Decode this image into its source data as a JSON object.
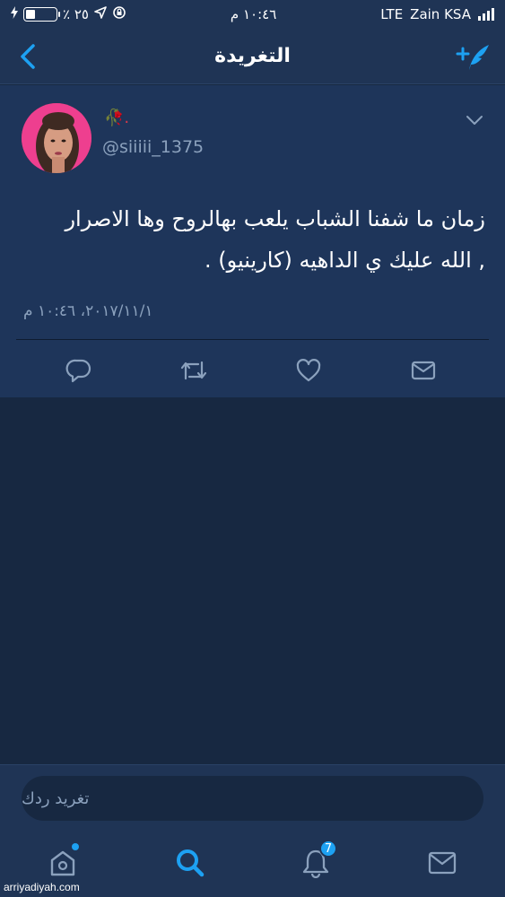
{
  "status_bar": {
    "battery_percent": "٪ ٢٥",
    "time": "١٠:٤٦ م",
    "network": "LTE",
    "carrier": "Zain KSA",
    "icons": [
      "charging-icon",
      "battery-icon",
      "location-icon",
      "rotation-lock-icon",
      "signal-icon"
    ]
  },
  "nav": {
    "title": "التغريدة",
    "back_icon": "chevron-left-icon",
    "compose_icon": "compose-tweet-icon"
  },
  "tweet": {
    "display_name": "🥀.",
    "handle": "@siiiii_1375",
    "text_lines": [
      "زمان ما شفنا الشباب يلعب بهالروح وها الاصرار",
      ", الله عليك ي الداهيه (كارينيو) ."
    ],
    "timestamp": "٢٠١٧/١١/١، ١٠:٤٦ م",
    "actions": [
      "reply-icon",
      "retweet-icon",
      "like-icon",
      "direct-message-icon"
    ]
  },
  "reply": {
    "placeholder": "تغريد ردك"
  },
  "tab_bar": {
    "tabs": [
      "home-icon",
      "search-icon",
      "notifications-icon",
      "messages-icon"
    ],
    "notifications_badge": "7"
  },
  "watermark": "arriyadiyah.com",
  "colors": {
    "background": "#172841",
    "card": "#1e355a",
    "bars": "#1f3455",
    "accent": "#1da1f2",
    "secondary_text": "#8ba1bd"
  }
}
